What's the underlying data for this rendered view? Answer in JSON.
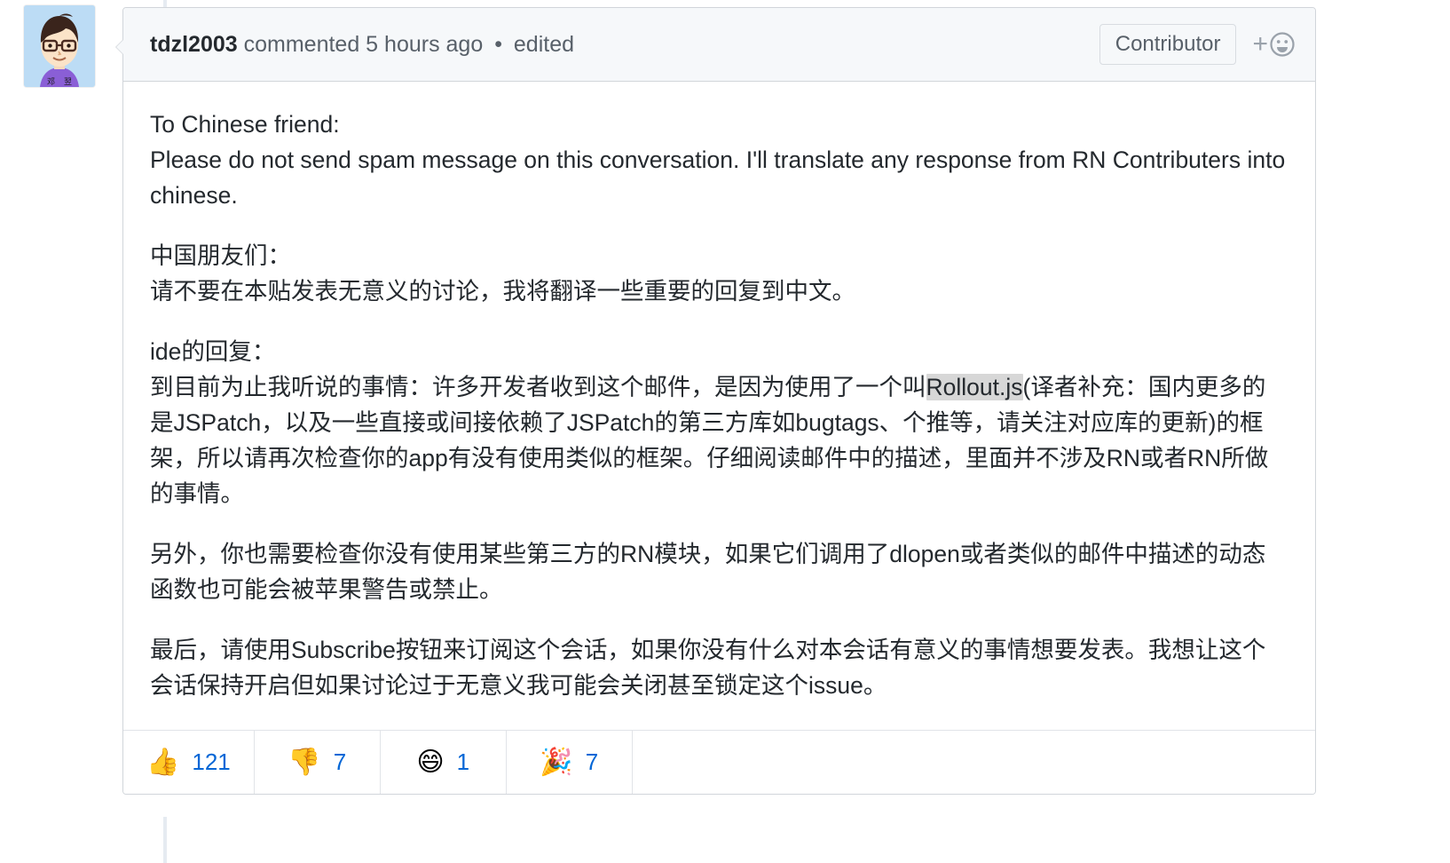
{
  "timeline": {
    "rail_color": "#e6ebf1"
  },
  "avatar": {
    "name": "tdzl2003-avatar",
    "alt": "tdzl2003",
    "caption": "邓 翌",
    "background": "#bcdcf5"
  },
  "header": {
    "author": "tdzl2003",
    "action": "commented 5 hours ago",
    "separator": "•",
    "edited_label": "edited",
    "badge": "Contributor",
    "add_reaction": {
      "plus": "+",
      "icon": "smiley-icon"
    }
  },
  "body": {
    "paragraphs": [
      {
        "id": "p-english",
        "lines": [
          "To Chinese friend:",
          "Please do not send spam message on this conversation. I'll translate any response from RN Contributers into chinese."
        ]
      },
      {
        "id": "p-chinese-intro",
        "lines": [
          "中国朋友们：",
          "请不要在本贴发表无意义的讨论，我将翻译一些重要的回复到中文。"
        ]
      },
      {
        "id": "p-ide-reply",
        "lines": [
          "ide的回复：",
          "到目前为止我听说的事情：许多开发者收到这个邮件，是因为使用了一个叫Rollout.js(译者补充：国内更多的是JSPatch，以及一些直接或间接依赖了JSPatch的第三方库如bugtags、个推等，请关注对应库的更新)的框架，所以请再次检查你的app有没有使用类似的框架。仔细阅读邮件中的描述，里面并不涉及RN或者RN所做的事情。"
        ],
        "highlight": "Rollout.js"
      },
      {
        "id": "p-third-party",
        "lines": [
          "另外，你也需要检查你没有使用某些第三方的RN模块，如果它们调用了dlopen或者类似的邮件中描述的动态函数也可能会被苹果警告或禁止。"
        ]
      },
      {
        "id": "p-subscribe",
        "lines": [
          "最后，请使用Subscribe按钮来订阅这个会话，如果你没有什么对本会话有意义的事情想要发表。我想让这个会话保持开启但如果讨论过于无意义我可能会关闭甚至锁定这个issue。"
        ]
      }
    ],
    "highlight_color": "#d7d7d7"
  },
  "reactions": [
    {
      "name": "thumbs-up",
      "emoji": "👍",
      "count": "121"
    },
    {
      "name": "thumbs-down",
      "emoji": "👎",
      "count": "7"
    },
    {
      "name": "smile",
      "emoji": "😄",
      "count": "1"
    },
    {
      "name": "tada",
      "emoji": "🎉",
      "count": "7"
    }
  ],
  "colors": {
    "link": "#0366d6",
    "text": "#24292e",
    "muted": "#586069",
    "border": "#d1d5da",
    "header_bg": "#f6f8fa"
  }
}
